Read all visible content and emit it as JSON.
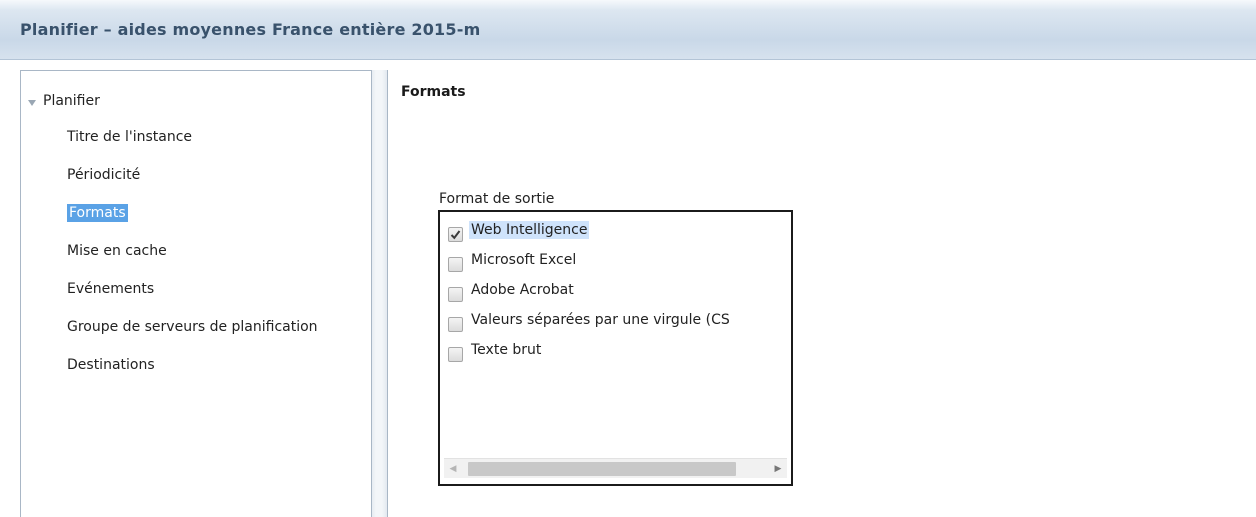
{
  "window": {
    "title": "Planifier – aides moyennes France entière 2015-m"
  },
  "sidebar": {
    "root_label": "Planifier",
    "root_expanded": true,
    "items": [
      {
        "label": "Titre de l'instance",
        "selected": false
      },
      {
        "label": "Périodicité",
        "selected": false
      },
      {
        "label": "Formats",
        "selected": true
      },
      {
        "label": "Mise en cache",
        "selected": false
      },
      {
        "label": "Evénements",
        "selected": false
      },
      {
        "label": "Groupe de serveurs de planification",
        "selected": false
      },
      {
        "label": "Destinations",
        "selected": false
      }
    ]
  },
  "main": {
    "section_title": "Formats",
    "output_format": {
      "label": "Format de sortie",
      "options": [
        {
          "label": "Web Intelligence",
          "checked": true,
          "selected": true
        },
        {
          "label": "Microsoft Excel",
          "checked": false,
          "selected": false
        },
        {
          "label": "Adobe Acrobat",
          "checked": false,
          "selected": false
        },
        {
          "label": "Valeurs séparées par une virgule (CS",
          "checked": false,
          "selected": false
        },
        {
          "label": "Texte brut",
          "checked": false,
          "selected": false
        }
      ]
    }
  },
  "colors": {
    "selection": "#5aa2e6",
    "title_text": "#39526c",
    "list_selection": "#cfe3fb"
  }
}
